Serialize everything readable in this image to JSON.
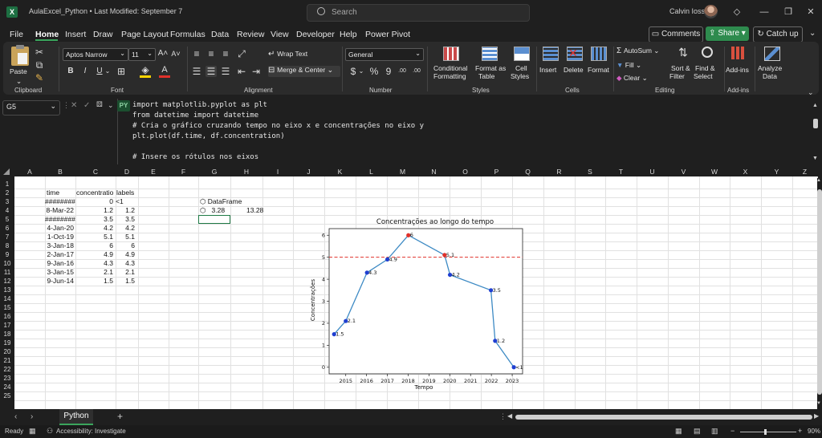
{
  "title_bar": {
    "doc_title": "AulaExcel_Python • Last Modified: September 7",
    "search_placeholder": "Search",
    "user_name": "Calvin Ioss"
  },
  "menu": {
    "tabs": [
      "File",
      "Home",
      "Insert",
      "Draw",
      "Page Layout",
      "Formulas",
      "Data",
      "Review",
      "View",
      "Developer",
      "Help",
      "Power Pivot"
    ],
    "comments_label": "Comments",
    "share_label": "Share",
    "catchup_label": "Catch up"
  },
  "ribbon": {
    "clipboard": {
      "paste": "Paste",
      "label": "Clipboard"
    },
    "font": {
      "name": "Aptos Narrow",
      "size": "11",
      "bold": "B",
      "italic": "I",
      "underline": "U",
      "grow": "A˄",
      "shrink": "A˅",
      "label": "Font"
    },
    "alignment": {
      "wrap": "Wrap Text",
      "merge": "Merge & Center",
      "label": "Alignment"
    },
    "number": {
      "format": "General",
      "currency": "$",
      "percent": "%",
      "comma": "9",
      "inc_dec": ".00",
      "dec_dec": ".00",
      "label": "Number"
    },
    "styles": {
      "conditional": [
        "Conditional",
        "Formatting"
      ],
      "format_table": [
        "Format as",
        "Table"
      ],
      "cell_styles": [
        "Cell",
        "Styles"
      ],
      "label": "Styles"
    },
    "cells": {
      "insert": "Insert",
      "delete": "Delete",
      "format": "Format",
      "label": "Cells"
    },
    "editing": {
      "autosum": "AutoSum",
      "fill": "Fill",
      "clear": "Clear",
      "sort": [
        "Sort &",
        "Filter"
      ],
      "find": [
        "Find &",
        "Select"
      ],
      "label": "Editing"
    },
    "addins": {
      "addins": "Add-ins",
      "label": "Add-ins"
    },
    "analyze": {
      "label": [
        "Analyze",
        "Data"
      ]
    }
  },
  "formula_bar": {
    "name_box": "G5",
    "py_badge": "PY",
    "lines": [
      "import matplotlib.pyplot as plt",
      "from datetime import datetime",
      "# Cria o gráfico cruzando tempo no eixo x e concentrações no eixo y",
      "plt.plot(df.time, df.concentration)",
      "",
      "# Insere os rótulos nos eixos"
    ]
  },
  "grid": {
    "columns": [
      "A",
      "B",
      "C",
      "D",
      "E",
      "F",
      "G",
      "H",
      "I",
      "J",
      "K",
      "L",
      "M",
      "N",
      "O",
      "P",
      "Q",
      "R",
      "S",
      "T",
      "U",
      "V",
      "W",
      "X",
      "Y",
      "Z"
    ],
    "rows": [
      "1",
      "2",
      "3",
      "4",
      "5",
      "6",
      "7",
      "8",
      "9",
      "10",
      "11",
      "12",
      "13",
      "14",
      "15",
      "16",
      "17",
      "18",
      "19",
      "20",
      "21",
      "22",
      "23",
      "24",
      "25"
    ],
    "headers": {
      "time": "time",
      "concentration": "concentratio",
      "labels": "labels"
    },
    "data": [
      {
        "time": "########",
        "conc": "0",
        "label": "<1"
      },
      {
        "time": "8-Mar-22",
        "conc": "1.2",
        "label": "1.2"
      },
      {
        "time": "########",
        "conc": "3.5",
        "label": "3.5"
      },
      {
        "time": "4-Jan-20",
        "conc": "4.2",
        "label": "4.2"
      },
      {
        "time": "1-Oct-19",
        "conc": "5.1",
        "label": "5.1"
      },
      {
        "time": "3-Jan-18",
        "conc": "6",
        "label": "6"
      },
      {
        "time": "2-Jan-17",
        "conc": "4.9",
        "label": "4.9"
      },
      {
        "time": "9-Jan-16",
        "conc": "4.3",
        "label": "4.3"
      },
      {
        "time": "3-Jan-15",
        "conc": "2.1",
        "label": "2.1"
      },
      {
        "time": "9-Jun-14",
        "conc": "1.5",
        "label": "1.5"
      }
    ],
    "dataframe_label": "DataFrame",
    "g4": "3.28",
    "h4": "13.28"
  },
  "chart_data": {
    "type": "line",
    "title": "Concentrações ao longo do tempo",
    "xlabel": "Tempo",
    "ylabel": "Concentrações",
    "x_ticks": [
      "2015",
      "2016",
      "2017",
      "2018",
      "2019",
      "2020",
      "2021",
      "2022",
      "2023"
    ],
    "y_ticks": [
      "0",
      "1",
      "2",
      "3",
      "4",
      "5",
      "6"
    ],
    "xlim": [
      2014.2,
      2023.5
    ],
    "ylim": [
      -0.3,
      6.3
    ],
    "threshold": 5,
    "threshold_color": "#e0312a",
    "line_color": "#3d8ac4",
    "points": [
      {
        "x": 2014.44,
        "y": 1.5,
        "label": "1.5",
        "color": "#1f3fd1"
      },
      {
        "x": 2015.0,
        "y": 2.1,
        "label": "2.1",
        "color": "#1f3fd1"
      },
      {
        "x": 2016.02,
        "y": 4.3,
        "label": "4.3",
        "color": "#1f3fd1"
      },
      {
        "x": 2017.0,
        "y": 4.9,
        "label": "4.9",
        "color": "#1f3fd1"
      },
      {
        "x": 2018.01,
        "y": 6,
        "label": "6",
        "color": "#e0312a"
      },
      {
        "x": 2019.75,
        "y": 5.1,
        "label": "5.1",
        "color": "#e0312a"
      },
      {
        "x": 2020.01,
        "y": 4.2,
        "label": "4.2",
        "color": "#1f3fd1"
      },
      {
        "x": 2021.98,
        "y": 3.5,
        "label": "3.5",
        "color": "#1f3fd1"
      },
      {
        "x": 2022.18,
        "y": 1.2,
        "label": "1.2",
        "color": "#1f3fd1"
      },
      {
        "x": 2023.08,
        "y": 0,
        "label": "<1",
        "color": "#1f3fd1"
      }
    ]
  },
  "sheet_tabs": {
    "active": "Python",
    "add": "+"
  },
  "status": {
    "ready": "Ready",
    "accessibility": "Accessibility: Investigate",
    "zoom": "90%"
  },
  "colors": {
    "accent_green": "#3aa55c",
    "share_green": "#2e8b4e"
  }
}
